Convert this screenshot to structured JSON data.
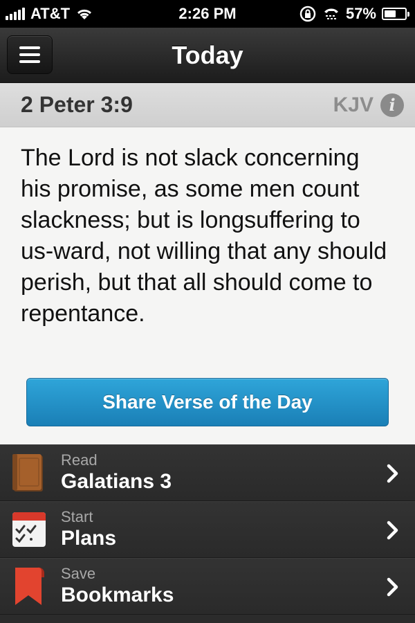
{
  "status_bar": {
    "carrier": "AT&T",
    "time": "2:26 PM",
    "battery": "57%",
    "battery_level": 0.57
  },
  "nav": {
    "title": "Today"
  },
  "verse": {
    "reference": "2 Peter 3:9",
    "version": "KJV",
    "text": "The Lord is not slack concerning his promise, as some men count slackness; but is longsuffering to us-ward, not willing that any should perish, but that all should come to repentance.",
    "share_label": "Share Verse of the Day"
  },
  "menu": {
    "items": [
      {
        "sub": "Read",
        "main": "Galatians 3",
        "icon": "book-icon"
      },
      {
        "sub": "Start",
        "main": "Plans",
        "icon": "calendar-icon"
      },
      {
        "sub": "Save",
        "main": "Bookmarks",
        "icon": "bookmark-icon"
      }
    ]
  },
  "colors": {
    "accent": "#1f8fc8",
    "nav_bg": "#262626",
    "card_bg": "#f5f5f4",
    "list_bg": "#2e2e2e"
  }
}
